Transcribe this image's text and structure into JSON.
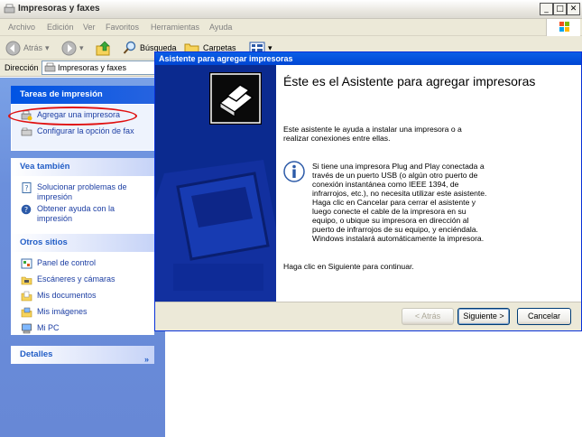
{
  "window": {
    "title": "Impresoras y faxes",
    "controls": [
      "_",
      "□",
      "✕"
    ]
  },
  "menu": [
    "Archivo",
    "Edición",
    "Ver",
    "Favoritos",
    "Herramientas",
    "Ayuda"
  ],
  "toolbar": {
    "back": "Atrás",
    "search": "Búsqueda",
    "folders": "Carpetas"
  },
  "address": {
    "label": "Dirección",
    "value": "Impresoras y faxes"
  },
  "taskpane": {
    "tasks": {
      "title": "Tareas de impresión",
      "items": [
        "Agregar una impresora",
        "Configurar la opción de fax"
      ]
    },
    "see_also": {
      "title": "Vea también",
      "items": [
        "Solucionar problemas de impresión",
        "Obtener ayuda con la impresión"
      ]
    },
    "other_places": {
      "title": "Otros sitios",
      "items": [
        "Panel de control",
        "Escáneres y cámaras",
        "Mis documentos",
        "Mis imágenes",
        "Mi PC"
      ]
    },
    "details": {
      "title": "Detalles",
      "chevron": "»"
    }
  },
  "wizard": {
    "title": "Asistente para agregar impresoras",
    "heading": "Éste es el Asistente para agregar impresoras",
    "intro": "Este asistente le ayuda a instalar una impresora o a realizar conexiones entre ellas.",
    "info": "Si tiene una impresora Plug and Play conectada a través de un puerto USB (o algún otro puerto de conexión instantánea como IEEE 1394, de infrarrojos, etc.), no necesita utilizar este asistente. Haga clic en Cancelar para cerrar el asistente y luego conecte el cable de la impresora en su equipo, o ubique su impresora en dirección al puerto de infrarrojos de su equipo, y enciéndala. Windows instalará automáticamente la impresora.",
    "continue": "Haga clic en Siguiente para continuar.",
    "buttons": {
      "back": "< Atrás",
      "next": "Siguiente >",
      "cancel": "Cancelar"
    }
  },
  "colors": {
    "taskpane_bg": "#6b8fdc",
    "header_blue": "#0054e3",
    "link": "#1c3ea3",
    "banner": "#0a2d9b",
    "annotation": "#e01010"
  }
}
